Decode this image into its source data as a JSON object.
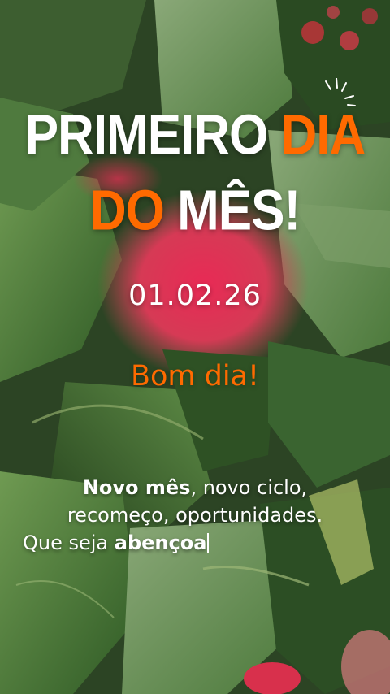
{
  "title": {
    "line1_white": "PRIMEIRO",
    "line1_orange": "DIA",
    "line2_orange": "DO",
    "line2_white": "MÊS!"
  },
  "date": "01.02.26",
  "greeting": "Bom dia!",
  "message": {
    "line1_bold": "Novo mês",
    "line1_rest": ", novo ciclo,",
    "line2": "recomeço, oportunidades.",
    "line3_plain": "Que seja ",
    "line3_bold": "abençoa"
  },
  "colors": {
    "accent": "#ff6a00",
    "text": "#ffffff"
  },
  "icons": [
    "sparkle-icon",
    "typing-caret-icon"
  ]
}
